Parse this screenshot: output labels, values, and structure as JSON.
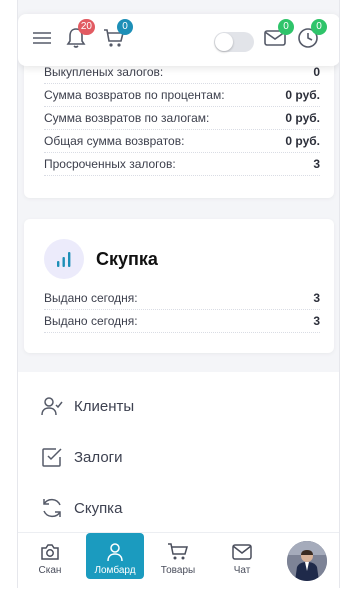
{
  "header": {
    "notifications_count": "20",
    "cart_count": "0",
    "mail_count": "0",
    "history_count": "0"
  },
  "pawn_stats": {
    "rows": [
      {
        "label": "Выкупленых залогов:",
        "value": "0"
      },
      {
        "label": "Сумма возвратов по процентам:",
        "value": "0 руб."
      },
      {
        "label": "Сумма возвратов по залогам:",
        "value": "0 руб."
      },
      {
        "label": "Общая сумма возвратов:",
        "value": "0 руб."
      },
      {
        "label": "Просроченных залогов:",
        "value": "3"
      }
    ]
  },
  "buyout": {
    "title": "Скупка",
    "rows": [
      {
        "label": "Выдано сегодня:",
        "value": "3"
      },
      {
        "label": "Выдано сегодня:",
        "value": "3"
      }
    ]
  },
  "menu": {
    "items": [
      {
        "label": "Клиенты",
        "icon": "user-check-icon"
      },
      {
        "label": "Залоги",
        "icon": "checkbox-icon"
      },
      {
        "label": "Скупка",
        "icon": "refresh-icon"
      }
    ]
  },
  "bottom_nav": {
    "items": [
      {
        "label": "Скан",
        "icon": "camera-icon"
      },
      {
        "label": "Ломбард",
        "icon": "user-icon"
      },
      {
        "label": "Товары",
        "icon": "cart-icon"
      },
      {
        "label": "Чат",
        "icon": "mail-icon"
      }
    ],
    "active": "Ломбард"
  },
  "colors": {
    "accent": "#1b9bbf",
    "badge_red": "#e25b62",
    "badge_blue": "#1d8fb7",
    "badge_green": "#2fc46a",
    "chart_icon_bg": "#ecebfb",
    "chart_icon": "#1d8fb7"
  }
}
